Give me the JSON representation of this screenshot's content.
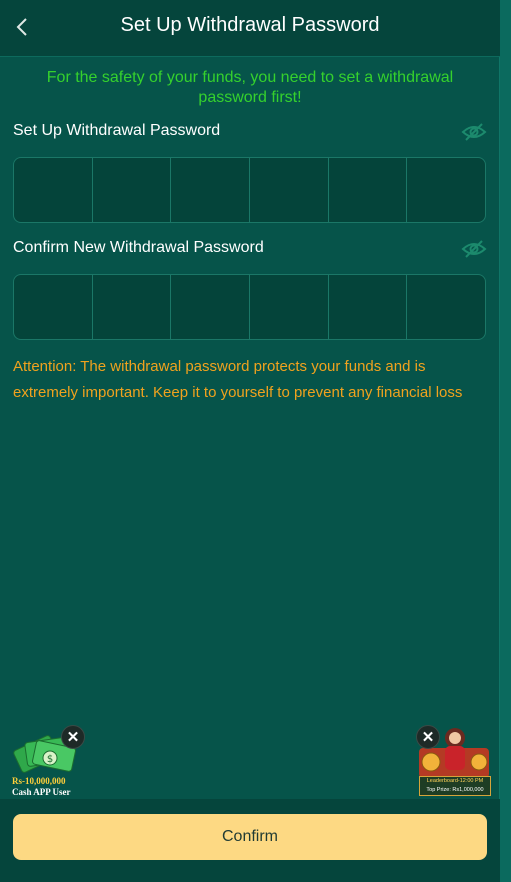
{
  "header": {
    "title": "Set Up Withdrawal Password"
  },
  "notice": "For the safety of your funds, you need to set a withdrawal password first!",
  "password_field": {
    "label": "Set Up Withdrawal Password",
    "digits": 6
  },
  "confirm_field": {
    "label": "Confirm New Withdrawal Password",
    "digits": 6
  },
  "attention": "Attention: The withdrawal password protects your funds and is extremely important. Keep it to yourself to prevent any financial loss",
  "promo_left": {
    "amount": "Rs-10,000,000",
    "caption": "Cash APP User"
  },
  "promo_right": {
    "line1": "Leaderboard-12:00 PM",
    "line2": "Top Prize: Rs1,000,000"
  },
  "confirm_button": "Confirm",
  "colors": {
    "accent_green": "#35d12d",
    "warning": "#f0a21e",
    "button": "#fdd983"
  }
}
